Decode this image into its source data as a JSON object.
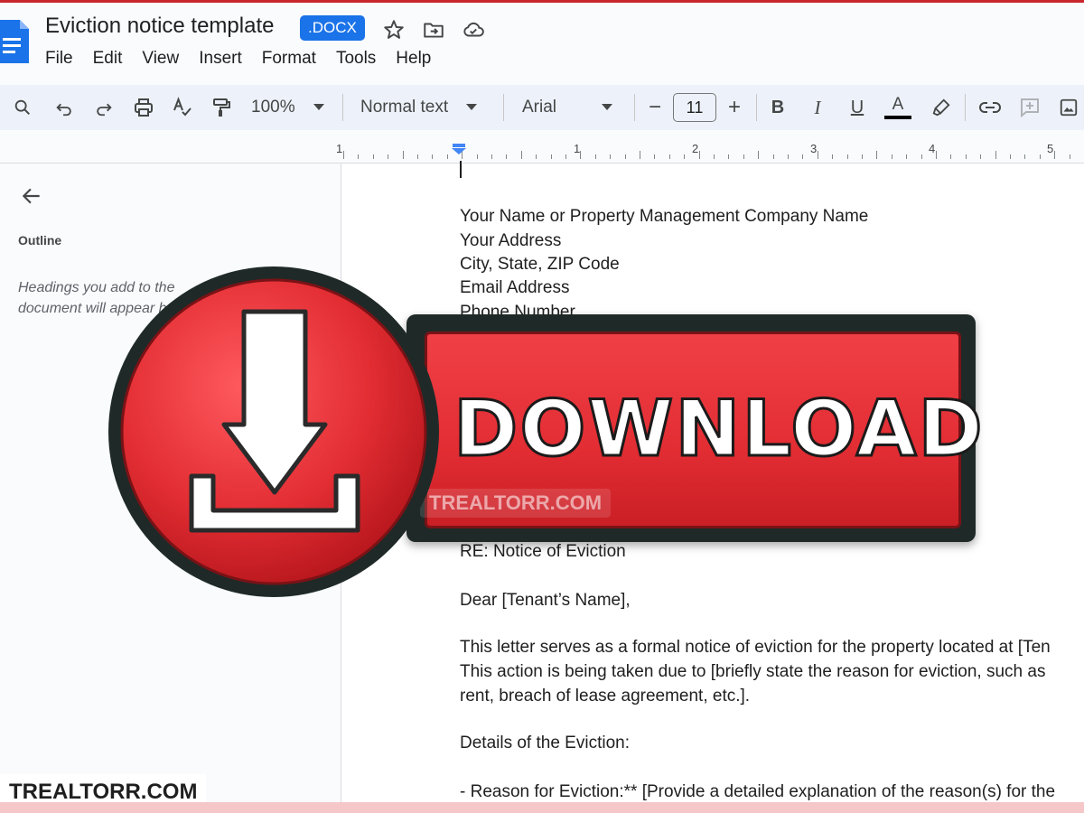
{
  "app": {
    "doc_title": "Eviction notice template",
    "file_badge": ".DOCX",
    "header_icons": [
      "star-icon",
      "move-folder-icon",
      "cloud-saved-icon"
    ],
    "accent_color": "#1a73e8"
  },
  "menu": [
    "File",
    "Edit",
    "View",
    "Insert",
    "Format",
    "Tools",
    "Help"
  ],
  "toolbar": {
    "zoom": "100%",
    "style": "Normal text",
    "font": "Arial",
    "font_size": "11",
    "minus": "−",
    "plus": "+",
    "bold": "B",
    "italic": "I",
    "underline": "U",
    "text_color": "A",
    "text_color_swatch": "#000000"
  },
  "ruler": {
    "labels": [
      "1",
      "1",
      "2",
      "3",
      "4",
      "5"
    ]
  },
  "sidebar": {
    "outline_label": "Outline",
    "outline_hint": "Headings you add to the document will appear here."
  },
  "document": {
    "lines": [
      "Your Name or Property Management Company Name",
      "Your Address",
      "City, State, ZIP Code",
      "Email Address",
      "Phone Number",
      "RE: Notice of Eviction",
      "Dear [Tenant’s Name],",
      "This letter serves as a formal notice of eviction for the property located at [Ten",
      "This action is being taken due to [briefly state the reason for eviction, such as",
      "rent, breach of lease agreement, etc.].",
      "Details of the Eviction:",
      "- Reason for Eviction:** [Provide a detailed explanation of the reason(s) for the"
    ]
  },
  "overlay": {
    "download_label": "DOWNLOAD",
    "watermark": "TREALTORR.COM",
    "brand": "TREALTORR.COM",
    "red": "#e22d33"
  }
}
